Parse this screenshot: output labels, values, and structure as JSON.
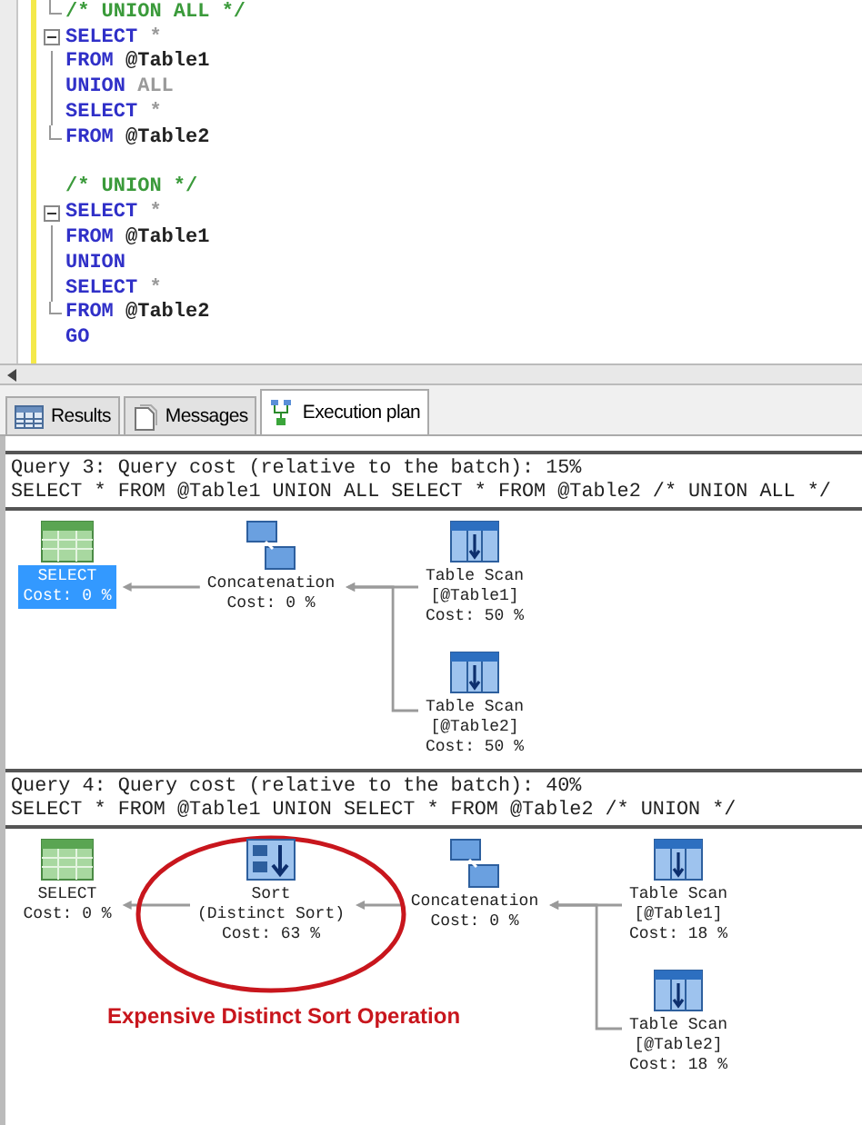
{
  "editor": {
    "lines": [
      {
        "kind": "end",
        "tokens": [
          {
            "kind": "comment",
            "text": "/* UNION ALL */"
          }
        ]
      },
      {
        "kind": "start",
        "tokens": [
          {
            "kind": "keyword",
            "text": "SELECT"
          },
          {
            "kind": "operator",
            "text": "*"
          }
        ]
      },
      {
        "kind": "body",
        "tokens": [
          {
            "kind": "keyword",
            "text": "FROM"
          },
          {
            "kind": "name",
            "text": "@Table1"
          }
        ]
      },
      {
        "kind": "body",
        "tokens": [
          {
            "kind": "keyword",
            "text": "UNION"
          },
          {
            "kind": "operator",
            "text": "ALL"
          }
        ]
      },
      {
        "kind": "body",
        "tokens": [
          {
            "kind": "keyword",
            "text": "SELECT"
          },
          {
            "kind": "operator",
            "text": "*"
          }
        ]
      },
      {
        "kind": "end",
        "tokens": [
          {
            "kind": "keyword",
            "text": "FROM"
          },
          {
            "kind": "name",
            "text": "@Table2"
          }
        ]
      },
      {
        "kind": "plain"
      },
      {
        "kind": "plain",
        "tokens": [
          {
            "kind": "comment",
            "text": "/* UNION */"
          }
        ]
      },
      {
        "kind": "start",
        "tokens": [
          {
            "kind": "keyword",
            "text": "SELECT"
          },
          {
            "kind": "operator",
            "text": "*"
          }
        ]
      },
      {
        "kind": "body",
        "tokens": [
          {
            "kind": "keyword",
            "text": "FROM"
          },
          {
            "kind": "name",
            "text": "@Table1"
          }
        ]
      },
      {
        "kind": "body",
        "tokens": [
          {
            "kind": "keyword",
            "text": "UNION"
          }
        ]
      },
      {
        "kind": "body",
        "tokens": [
          {
            "kind": "keyword",
            "text": "SELECT"
          },
          {
            "kind": "operator",
            "text": "*"
          }
        ]
      },
      {
        "kind": "end",
        "tokens": [
          {
            "kind": "keyword",
            "text": "FROM"
          },
          {
            "kind": "name",
            "text": "@Table2"
          }
        ]
      },
      {
        "kind": "plain",
        "tokens": [
          {
            "kind": "keyword",
            "text": "GO"
          }
        ]
      }
    ]
  },
  "tabs": [
    {
      "label": "Results",
      "kind": "grid",
      "selected": false
    },
    {
      "label": "Messages",
      "kind": "messages",
      "selected": false
    },
    {
      "label": "Execution plan",
      "kind": "plan",
      "selected": true
    }
  ],
  "plans": [
    {
      "header": "Query 3: Query cost (relative to the batch): 15%",
      "statement": "SELECT * FROM @Table1 UNION ALL SELECT * FROM @Table2 /* UNION ALL */",
      "root": {
        "kind": "select",
        "lines": [
          "SELECT",
          "Cost: 0 %"
        ],
        "selected": true,
        "children": [
          {
            "kind": "concatenation",
            "lines": [
              "Concatenation",
              "Cost: 0 %"
            ],
            "selected": false,
            "children": [
              {
                "kind": "table_scan",
                "lines": [
                  "Table Scan",
                  "[@Table1]",
                  "Cost: 50 %"
                ],
                "selected": false
              },
              {
                "kind": "table_scan",
                "lines": [
                  "Table Scan",
                  "[@Table2]",
                  "Cost: 50 %"
                ],
                "selected": false
              }
            ]
          }
        ]
      }
    },
    {
      "header": "Query 4: Query cost (relative to the batch): 40%",
      "statement": "SELECT * FROM @Table1 UNION SELECT * FROM @Table2 /* UNION */",
      "annotation": "Expensive Distinct Sort Operation",
      "root": {
        "kind": "select",
        "lines": [
          "SELECT",
          "Cost: 0 %"
        ],
        "selected": false,
        "children": [
          {
            "kind": "sort",
            "lines": [
              "Sort",
              "(Distinct Sort)",
              "Cost: 63 %"
            ],
            "selected": false,
            "circled": true,
            "children": [
              {
                "kind": "concatenation",
                "lines": [
                  "Concatenation",
                  "Cost: 0 %"
                ],
                "selected": false,
                "children": [
                  {
                    "kind": "table_scan",
                    "lines": [
                      "Table Scan",
                      "[@Table1]",
                      "Cost: 18 %"
                    ],
                    "selected": false
                  },
                  {
                    "kind": "table_scan",
                    "lines": [
                      "Table Scan",
                      "[@Table2]",
                      "Cost: 18 %"
                    ],
                    "selected": false
                  }
                ]
              }
            ]
          }
        ]
      }
    }
  ]
}
